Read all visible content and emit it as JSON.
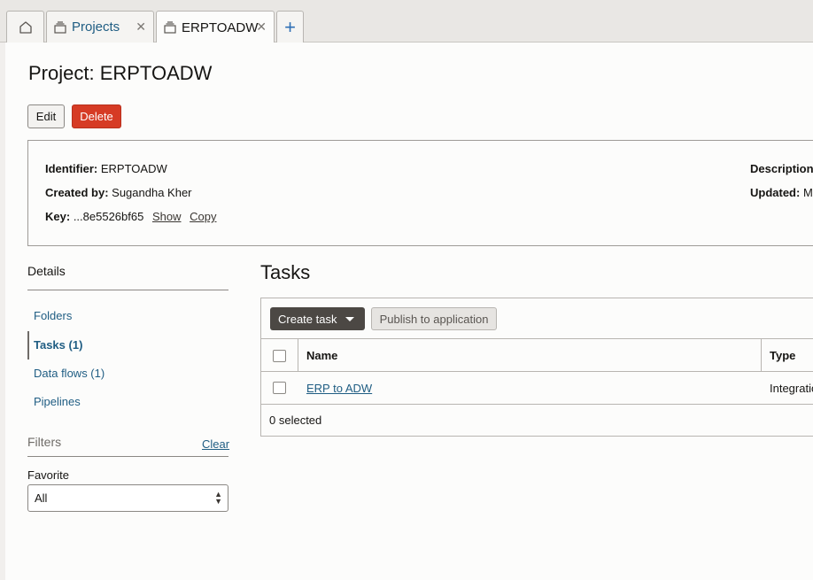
{
  "tabs": [
    {
      "label": ""
    },
    {
      "label": "Projects"
    },
    {
      "label": "ERPTOADW"
    }
  ],
  "page": {
    "title": "Project: ERPTOADW",
    "edit_label": "Edit",
    "delete_label": "Delete"
  },
  "info": {
    "identifier_label": "Identifier:",
    "identifier_value": "ERPTOADW",
    "created_by_label": "Created by:",
    "created_by_value": "Sugandha Kher",
    "key_label": "Key:",
    "key_value": "...8e5526bf65",
    "show_label": "Show",
    "copy_label": "Copy",
    "description_label": "Description:",
    "updated_label": "Updated:",
    "updated_value": "Mo"
  },
  "sidebar": {
    "heading": "Details",
    "items": [
      {
        "label": "Folders"
      },
      {
        "label": "Tasks (1)"
      },
      {
        "label": "Data flows (1)"
      },
      {
        "label": "Pipelines"
      }
    ],
    "filters_heading": "Filters",
    "clear_label": "Clear",
    "favorite_label": "Favorite",
    "favorite_value": "All"
  },
  "tasks": {
    "heading": "Tasks",
    "create_label": "Create task",
    "publish_label": "Publish to application",
    "columns": [
      "Name",
      "Type"
    ],
    "rows": [
      {
        "name": "ERP to ADW",
        "type": "Integratio"
      }
    ],
    "selected_text": "0 selected"
  },
  "colors": {
    "accent_link": "#1f5d83",
    "delete_button": "#d63b25",
    "create_button": "#4c4844"
  }
}
